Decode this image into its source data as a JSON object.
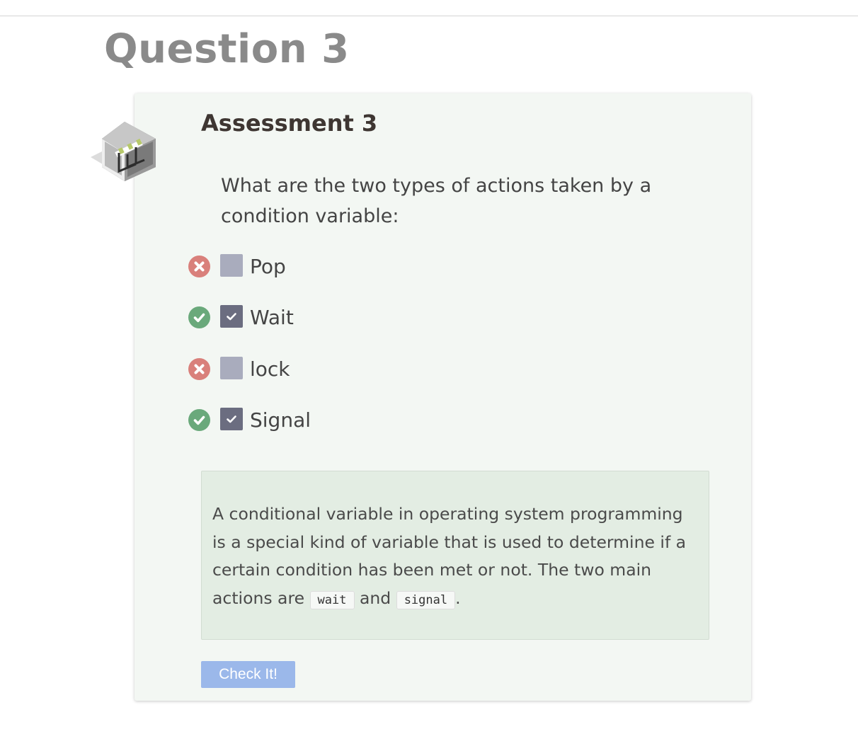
{
  "page": {
    "title": "Question 3"
  },
  "assessment": {
    "title": "Assessment 3",
    "icon": "hurdle-icon",
    "question": "What are the two types of actions taken by a condition variable:",
    "options": [
      {
        "label": "Pop",
        "checked": false,
        "status": "incorrect",
        "status_icon": "x-circle-icon"
      },
      {
        "label": "Wait",
        "checked": true,
        "status": "correct",
        "status_icon": "check-circle-icon"
      },
      {
        "label": "lock",
        "checked": false,
        "status": "incorrect",
        "status_icon": "x-circle-icon"
      },
      {
        "label": "Signal",
        "checked": true,
        "status": "correct",
        "status_icon": "check-circle-icon"
      }
    ],
    "explanation": {
      "text_before": "A conditional variable in operating system programming is a special kind of variable that is used to determine if a certain condition has been met or not. The two main actions are",
      "code_1": "wait",
      "text_between": "and",
      "code_2": "signal",
      "text_after": "."
    },
    "check_button_label": "Check It!"
  },
  "colors": {
    "correct": "#6aa97b",
    "incorrect": "#d9807b",
    "checkbox_checked": "#6b6d80",
    "checkbox_unchecked": "#a9acbd",
    "button": "#9bb8ea",
    "card_background": "#f3f7f3",
    "explanation_background": "#e3ede3"
  }
}
